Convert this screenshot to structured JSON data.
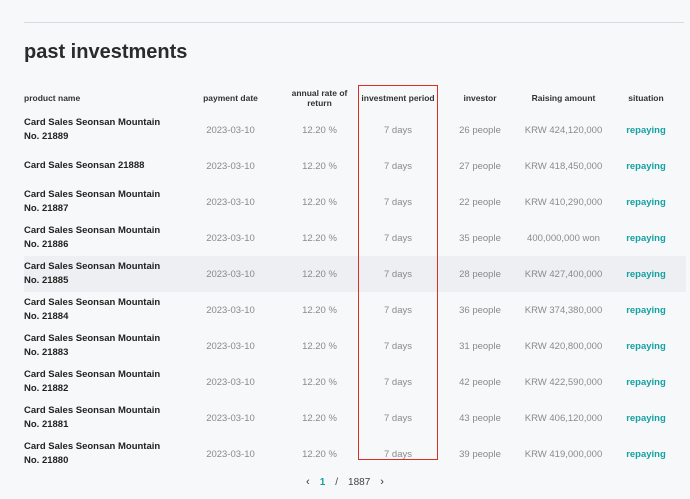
{
  "title": "past investments",
  "columns": {
    "name": "product name",
    "date": "payment date",
    "rate": "annual rate of return",
    "period": "investment period",
    "investor": "investor",
    "amount": "Raising amount",
    "status": "situation"
  },
  "rows": [
    {
      "name": "Card Sales Seonsan Mountain No. 21889",
      "date": "2023-03-10",
      "rate": "12.20 %",
      "period": "7 days",
      "investor": "26 people",
      "amount": "KRW 424,120,000",
      "status": "repaying"
    },
    {
      "name": "Card Sales Seonsan 21888",
      "date": "2023-03-10",
      "rate": "12.20 %",
      "period": "7 days",
      "investor": "27 people",
      "amount": "KRW 418,450,000",
      "status": "repaying"
    },
    {
      "name": "Card Sales Seonsan Mountain No. 21887",
      "date": "2023-03-10",
      "rate": "12.20 %",
      "period": "7 days",
      "investor": "22 people",
      "amount": "KRW 410,290,000",
      "status": "repaying"
    },
    {
      "name": "Card Sales Seonsan Mountain No. 21886",
      "date": "2023-03-10",
      "rate": "12.20 %",
      "period": "7 days",
      "investor": "35 people",
      "amount": "400,000,000 won",
      "status": "repaying"
    },
    {
      "name": "Card Sales Seonsan Mountain No. 21885",
      "date": "2023-03-10",
      "rate": "12.20 %",
      "period": "7 days",
      "investor": "28 people",
      "amount": "KRW 427,400,000",
      "status": "repaying"
    },
    {
      "name": "Card Sales Seonsan Mountain No. 21884",
      "date": "2023-03-10",
      "rate": "12.20 %",
      "period": "7 days",
      "investor": "36 people",
      "amount": "KRW 374,380,000",
      "status": "repaying"
    },
    {
      "name": "Card Sales Seonsan Mountain No. 21883",
      "date": "2023-03-10",
      "rate": "12.20 %",
      "period": "7 days",
      "investor": "31 people",
      "amount": "KRW 420,800,000",
      "status": "repaying"
    },
    {
      "name": "Card Sales Seonsan Mountain No. 21882",
      "date": "2023-03-10",
      "rate": "12.20 %",
      "period": "7 days",
      "investor": "42 people",
      "amount": "KRW 422,590,000",
      "status": "repaying"
    },
    {
      "name": "Card Sales Seonsan Mountain No. 21881",
      "date": "2023-03-10",
      "rate": "12.20 %",
      "period": "7 days",
      "investor": "43 people",
      "amount": "KRW 406,120,000",
      "status": "repaying"
    },
    {
      "name": "Card Sales Seonsan Mountain No. 21880",
      "date": "2023-03-10",
      "rate": "12.20 %",
      "period": "7 days",
      "investor": "39 people",
      "amount": "KRW 419,000,000",
      "status": "repaying"
    }
  ],
  "pagination": {
    "prev_icon": "chevron-left-icon",
    "current": "1",
    "separator": "/",
    "total": "1887",
    "next_icon": "chevron-right-icon"
  },
  "colors": {
    "accent": "#14a1a1",
    "highlight_border": "#d93025"
  }
}
